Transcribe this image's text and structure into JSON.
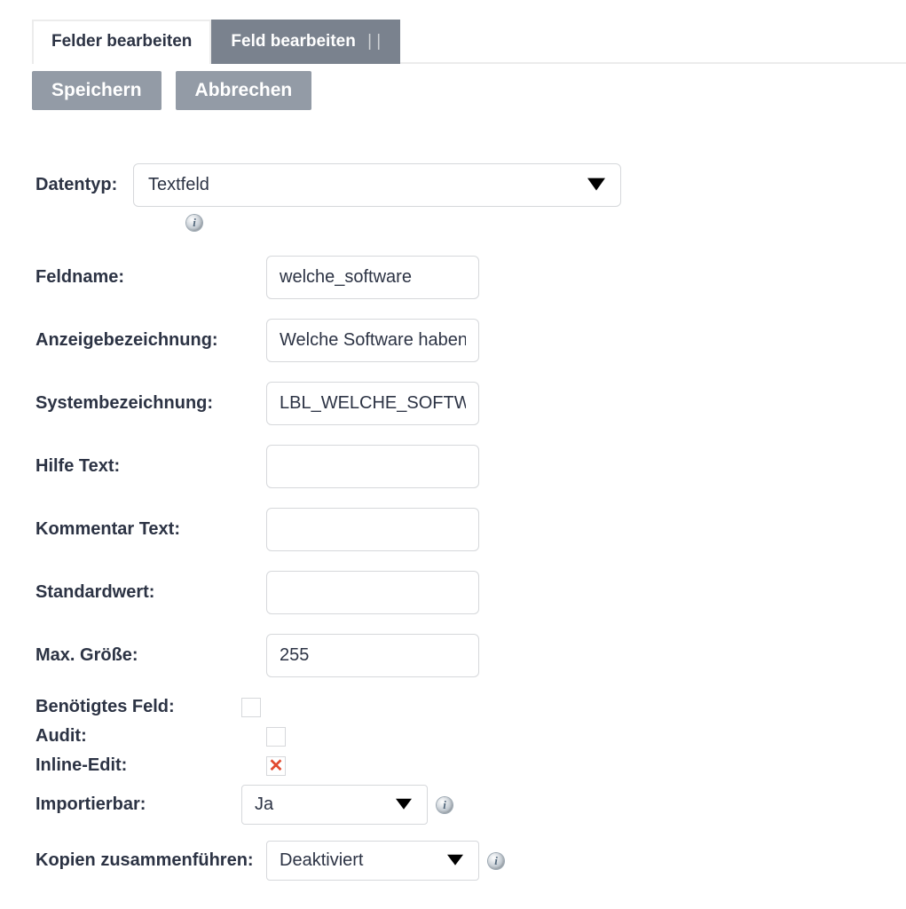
{
  "tabs": {
    "inactive": "Felder bearbeiten",
    "active": "Feld bearbeiten"
  },
  "toolbar": {
    "save": "Speichern",
    "cancel": "Abbrechen"
  },
  "form": {
    "datatype": {
      "label": "Datentyp:",
      "value": "Textfeld"
    },
    "fieldname": {
      "label": "Feldname:",
      "value": "welche_software"
    },
    "displaylabel": {
      "label": "Anzeigebezeichnung:",
      "value": "Welche Software haben"
    },
    "systemlabel": {
      "label": "Systembezeichnung:",
      "value": "LBL_WELCHE_SOFTWA"
    },
    "helptext": {
      "label": "Hilfe Text:",
      "value": ""
    },
    "commenttext": {
      "label": "Kommentar Text:",
      "value": ""
    },
    "defaultvalue": {
      "label": "Standardwert:",
      "value": ""
    },
    "maxsize": {
      "label": "Max. Größe:",
      "value": "255"
    },
    "required": {
      "label": "Benötigtes Feld:",
      "checked": false
    },
    "audit": {
      "label": "Audit:",
      "checked": false
    },
    "inlineedit": {
      "label": "Inline-Edit:",
      "state": "x"
    },
    "importable": {
      "label": "Importierbar:",
      "value": "Ja"
    },
    "mergecopies": {
      "label": "Kopien zusammenführen:",
      "value": "Deaktiviert"
    }
  }
}
